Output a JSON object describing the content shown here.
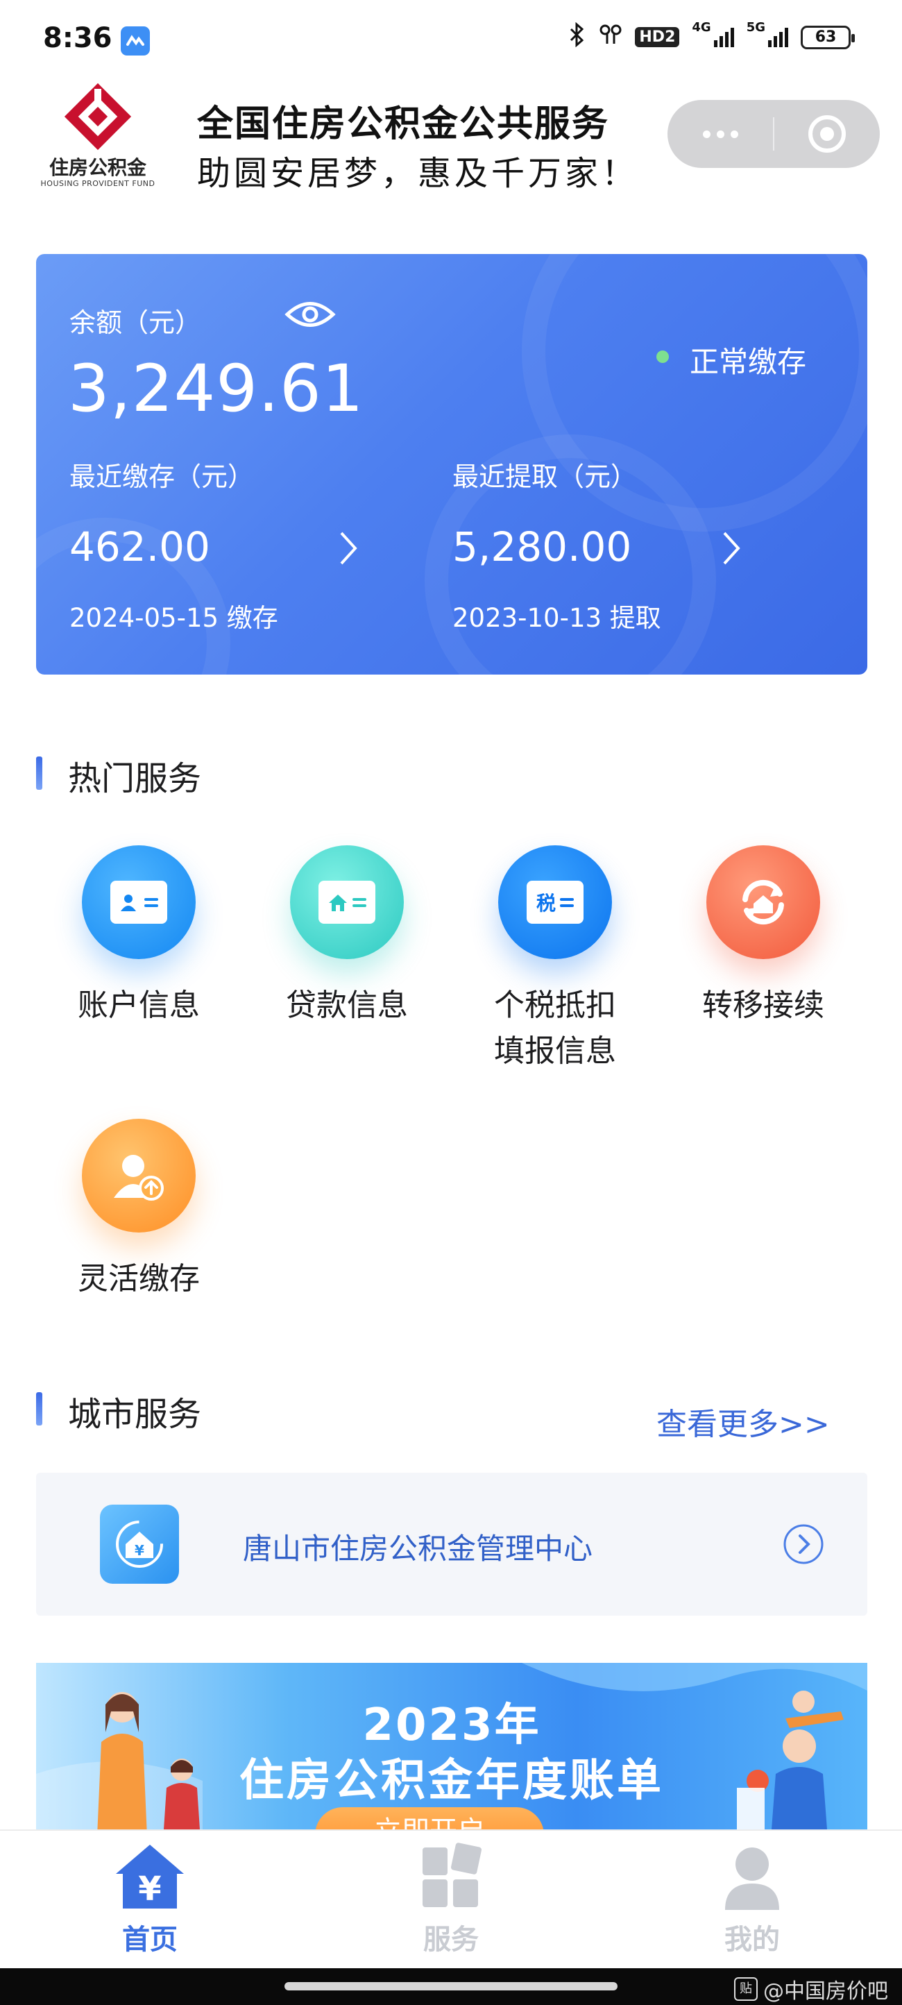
{
  "status_bar": {
    "time": "8:36",
    "hd": "HD2",
    "net_4g": "4G",
    "net_5g": "5G",
    "battery": "63"
  },
  "header": {
    "logo_text": "住房公积金",
    "logo_sub": "HOUSING PROVIDENT FUND",
    "title": "全国住房公积金公共服务",
    "slogan": "助圆安居梦，惠及千万家！"
  },
  "balance": {
    "label": "余额（元）",
    "amount": "3,249.61",
    "status": "正常缴存",
    "recent_deposit": {
      "label": "最近缴存（元）",
      "amount": "462.00",
      "date": "2024-05-15 缴存"
    },
    "recent_withdraw": {
      "label": "最近提取（元）",
      "amount": "5,280.00",
      "date": "2023-10-13 提取"
    }
  },
  "hot_services": {
    "title": "热门服务",
    "items": [
      {
        "label_line1": "账户信息",
        "label_line2": "",
        "icon": "account-card-icon",
        "color": "#1387f2"
      },
      {
        "label_line1": "贷款信息",
        "label_line2": "",
        "icon": "house-card-icon",
        "color": "#2cc9c1"
      },
      {
        "label_line1": "个税抵扣",
        "label_line2": "填报信息",
        "icon": "tax-card-icon",
        "icon_text": "税",
        "color": "#0c74ee"
      },
      {
        "label_line1": "转移接续",
        "label_line2": "",
        "icon": "transfer-icon",
        "color": "#f2593b"
      },
      {
        "label_line1": "灵活缴存",
        "label_line2": "",
        "icon": "person-upload-icon",
        "color": "#ff8e24"
      }
    ]
  },
  "city_services": {
    "title": "城市服务",
    "more": "查看更多>>",
    "item": "唐山市住房公积金管理中心"
  },
  "banner": {
    "year": "2023年",
    "title": "住房公积金年度账单",
    "button": "立即开启"
  },
  "tabs": [
    {
      "label": "首页",
      "icon": "home-yuan-icon",
      "active": true
    },
    {
      "label": "服务",
      "icon": "grid-icon",
      "active": false
    },
    {
      "label": "我的",
      "icon": "user-icon",
      "active": false
    }
  ],
  "watermark": {
    "badge": "贴",
    "text": "@中国房价吧"
  },
  "colors": {
    "accent": "#3a6fe0",
    "card_start": "#6b9cf6",
    "card_end": "#3b6ae6",
    "status_dot": "#7ee08f",
    "tab_inactive": "#c9ccd2"
  }
}
